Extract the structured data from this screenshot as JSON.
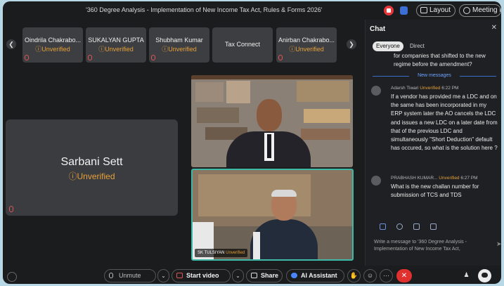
{
  "topbar": {
    "title": "'360 Degree Analysis - Implementation of New Income Tax Act, Rules & Forms 2026'",
    "layout_label": "Layout",
    "info_label": "Meeting info"
  },
  "participants": [
    {
      "name": "Oindrila Chakrabo...",
      "status": "Unverified"
    },
    {
      "name": "SUKALYAN GUPTA",
      "status": "Unverified"
    },
    {
      "name": "Shubham Kumar",
      "status": "Unverified"
    },
    {
      "name": "Tax Connect",
      "status": ""
    },
    {
      "name": "Anirban Chakrabo...",
      "status": "Unverified"
    }
  ],
  "speaker": {
    "name": "Sarbani Sett",
    "status": "Unverified"
  },
  "video2_tag": {
    "name": "SK TULSIYAN",
    "status": "Unverified"
  },
  "chat": {
    "title": "Chat",
    "tab_everyone": "Everyone",
    "tab_direct": "Direct",
    "continued_text": "for companies that shifted to the new regime before the amendment?",
    "new_messages_label": "New messages",
    "messages": [
      {
        "author": "Adarsh Tiwari",
        "status": "Unverified",
        "time": "6:22 PM",
        "text": "If a vendor has provided me a LDC and on the same has been incorporated in my ERP system later the AO cancels the LDC and issues a new LDC on a later date from that of the previous LDC and simultaneously \"Short Deduction\" default has occured, so what is the solution here ?"
      },
      {
        "author": "PRABHASH KUMAR...",
        "status": "Unverified",
        "time": "6:27 PM",
        "text": "What is the new challan number for submission of TCS and TDS"
      }
    ],
    "input_placeholder": "Write a message to '360 Degree Analysis - Implementation of New Income Tax Act,"
  },
  "bottombar": {
    "unmute_label": "Unmute",
    "start_video_label": "Start video",
    "share_label": "Share",
    "ai_label": "AI Assistant",
    "more_label": "···"
  }
}
